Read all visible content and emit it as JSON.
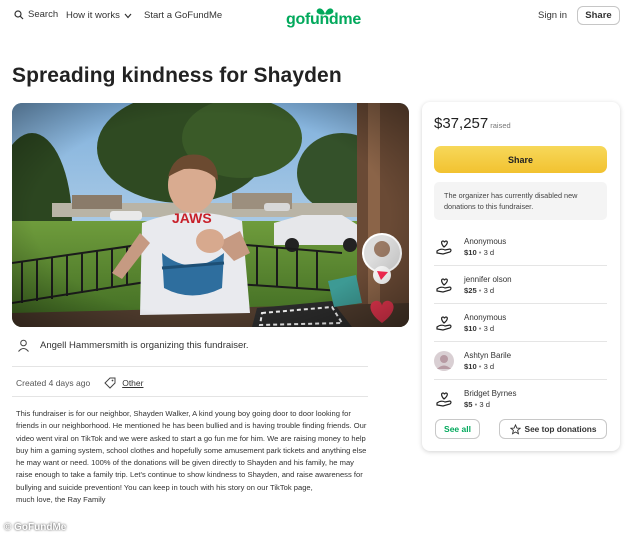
{
  "header": {
    "search_label": "Search",
    "how_label": "How it works",
    "start_label": "Start a GoFundMe",
    "logo": "gofundme",
    "signin_label": "Sign in",
    "share_label": "Share"
  },
  "campaign": {
    "title": "Spreading kindness for Shayden",
    "organizer_text": "Angell Hammersmith is organizing this fundraiser.",
    "created": "Created 4 days ago",
    "category": "Other",
    "story": "This fundraiser is for our neighbor, Shayden Walker, A kind young boy going door to door looking for friends in our neighborhood. He mentioned he has been bullied and is having trouble finding friends. Our video went viral on TikTok and we were asked to start a go fun me for him. We are raising money to help buy him a gaming system, school clothes and hopefully some amusement park tickets and anything else he may want or need. 100% of the donations will be given directly to Shayden and his family, he may raise enough to take a family trip. Let's continue to show kindness to Shayden, and raise awareness for bullying and suicide prevention! You can keep in touch with his story on our TikTok page,",
    "signoff": "much love, the Ray Family"
  },
  "sidebar": {
    "amount": "$37,257",
    "raised_label": "raised",
    "share_label": "Share",
    "notice": "The organizer has currently disabled new donations to this fundraiser.",
    "donors": [
      {
        "name": "Anonymous",
        "amount": "$10",
        "time": "3 d",
        "icon": "donation-hand-icon"
      },
      {
        "name": "jennifer olson",
        "amount": "$25",
        "time": "3 d",
        "icon": "donation-hand-icon"
      },
      {
        "name": "Anonymous",
        "amount": "$10",
        "time": "3 d",
        "icon": "donation-hand-icon"
      },
      {
        "name": "Ashtyn Barile",
        "amount": "$10",
        "time": "3 d",
        "icon": "avatar-photo"
      },
      {
        "name": "Bridget Byrnes",
        "amount": "$5",
        "time": "3 d",
        "icon": "donation-hand-icon"
      }
    ],
    "see_all_label": "See all",
    "see_top_label": "See top donations"
  },
  "watermark": "© GoFundMe",
  "colors": {
    "brand_green": "#02a95c",
    "share_yellow": "#f2c230",
    "heart_red": "#e8364f"
  }
}
